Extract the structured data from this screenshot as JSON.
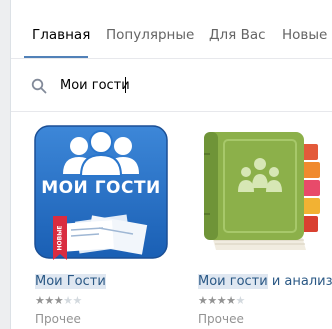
{
  "tabs": [
    {
      "label": "Главная",
      "active": true
    },
    {
      "label": "Популярные",
      "active": false
    },
    {
      "label": "Для Вас",
      "active": false
    },
    {
      "label": "Новые",
      "active": false
    }
  ],
  "search": {
    "value": "Мои гости",
    "icon": "search-icon"
  },
  "apps": [
    {
      "name_highlight": "Мои Гости",
      "name_rest": "",
      "icon_text": "МОИ ГОСТИ",
      "badge": "НОВЫЕ",
      "rating": 3,
      "rating_max": 5,
      "category": "Прочее"
    },
    {
      "name_highlight": "Мои гости",
      "name_rest": " и анализ",
      "rating": 4,
      "rating_max": 5,
      "category": "Прочее"
    }
  ],
  "colors": {
    "accent": "#5181b8",
    "link": "#2a5885",
    "highlight": "#dfe7f1"
  }
}
